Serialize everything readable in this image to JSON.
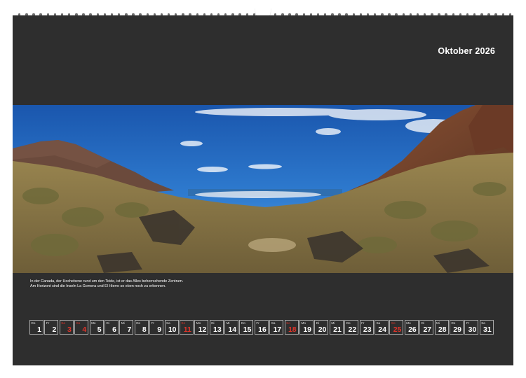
{
  "calendar": {
    "month_title": "Oktober 2026",
    "caption": {
      "line1": "In der Canada, der Hochebene rund um den Teide, ist er das Alles beherrschende Zentrum.",
      "line2": "Am Horizont sind die Inseln La Gomera und El Hierro so eben noch zu erkennen."
    },
    "photo": {
      "subject": "mountain landscape photo",
      "colors": {
        "sky": "#1e5fb4",
        "ground": "#8a7a45",
        "rock": "#7a4a30"
      }
    },
    "days": [
      {
        "wd": "Do",
        "n": "1",
        "holiday": false
      },
      {
        "wd": "Fr",
        "n": "2",
        "holiday": false
      },
      {
        "wd": "Sa",
        "n": "3",
        "holiday": true
      },
      {
        "wd": "So",
        "n": "4",
        "holiday": true
      },
      {
        "wd": "Mo",
        "n": "5",
        "holiday": false
      },
      {
        "wd": "Di",
        "n": "6",
        "holiday": false
      },
      {
        "wd": "Mi",
        "n": "7",
        "holiday": false
      },
      {
        "wd": "Do",
        "n": "8",
        "holiday": false
      },
      {
        "wd": "Fr",
        "n": "9",
        "holiday": false
      },
      {
        "wd": "Sa",
        "n": "10",
        "holiday": false
      },
      {
        "wd": "So",
        "n": "11",
        "holiday": true
      },
      {
        "wd": "Mo",
        "n": "12",
        "holiday": false
      },
      {
        "wd": "Di",
        "n": "13",
        "holiday": false
      },
      {
        "wd": "Mi",
        "n": "14",
        "holiday": false
      },
      {
        "wd": "Do",
        "n": "15",
        "holiday": false
      },
      {
        "wd": "Fr",
        "n": "16",
        "holiday": false
      },
      {
        "wd": "Sa",
        "n": "17",
        "holiday": false
      },
      {
        "wd": "So",
        "n": "18",
        "holiday": true
      },
      {
        "wd": "Mo",
        "n": "19",
        "holiday": false
      },
      {
        "wd": "Di",
        "n": "20",
        "holiday": false
      },
      {
        "wd": "Mi",
        "n": "21",
        "holiday": false
      },
      {
        "wd": "Do",
        "n": "22",
        "holiday": false
      },
      {
        "wd": "Fr",
        "n": "23",
        "holiday": false
      },
      {
        "wd": "Sa",
        "n": "24",
        "holiday": false
      },
      {
        "wd": "So",
        "n": "25",
        "holiday": true
      },
      {
        "wd": "Mo",
        "n": "26",
        "holiday": false
      },
      {
        "wd": "Di",
        "n": "27",
        "holiday": false
      },
      {
        "wd": "Mi",
        "n": "28",
        "holiday": false
      },
      {
        "wd": "Do",
        "n": "29",
        "holiday": false
      },
      {
        "wd": "Fr",
        "n": "30",
        "holiday": false
      },
      {
        "wd": "Sa",
        "n": "31",
        "holiday": false
      }
    ]
  }
}
